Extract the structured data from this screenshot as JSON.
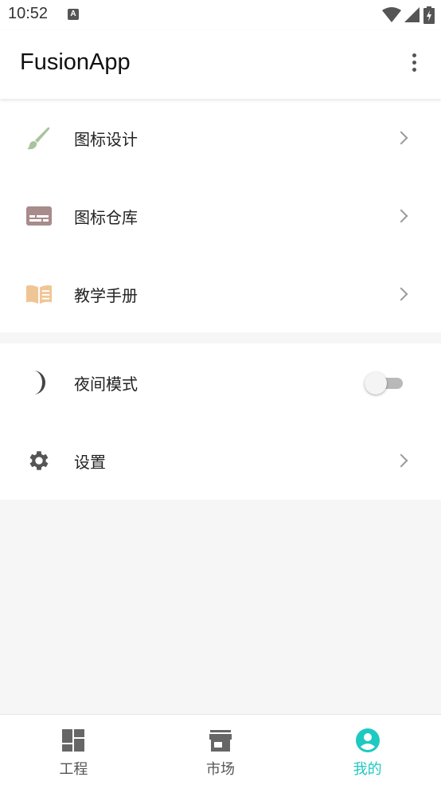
{
  "status_bar": {
    "time": "10:52",
    "notification_icon": "A"
  },
  "app_bar": {
    "title": "FusionApp",
    "menu_icon": "more-vert-icon"
  },
  "menu_group_1": [
    {
      "label": "图标设计",
      "icon": "brush-icon",
      "icon_color": "#a8c49c"
    },
    {
      "label": "图标仓库",
      "icon": "subtitles-icon",
      "icon_color": "#a88b8b"
    },
    {
      "label": "教学手册",
      "icon": "book-icon",
      "icon_color": "#f0c596"
    }
  ],
  "menu_group_2": {
    "night_mode": {
      "label": "夜间模式",
      "icon": "moon-icon",
      "enabled": false
    },
    "settings": {
      "label": "设置",
      "icon": "gear-icon"
    }
  },
  "bottom_nav": [
    {
      "label": "工程",
      "icon": "dashboard-icon",
      "active": false
    },
    {
      "label": "市场",
      "icon": "store-icon",
      "active": false
    },
    {
      "label": "我的",
      "icon": "account-circle-icon",
      "active": true
    }
  ],
  "colors": {
    "accent": "#1ec9c1",
    "icon_gray": "#666666",
    "background": "#f6f6f6"
  }
}
